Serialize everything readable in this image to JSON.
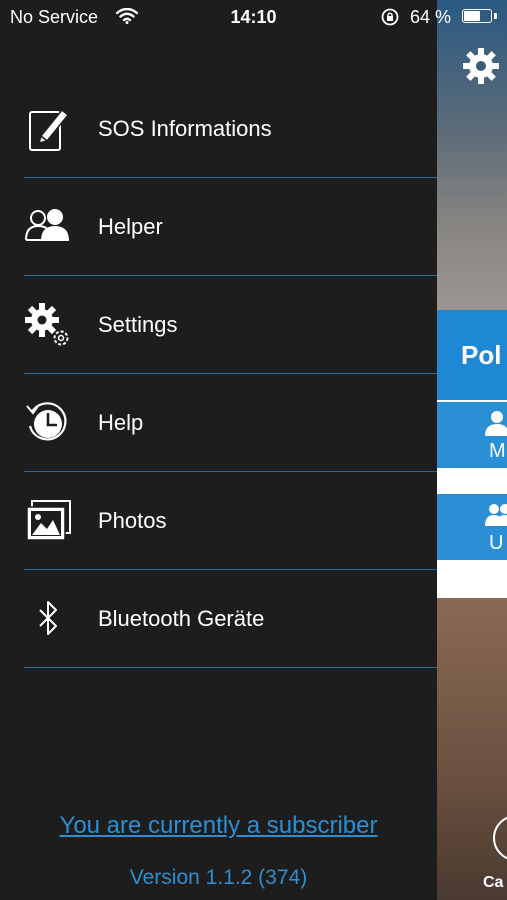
{
  "status_bar": {
    "carrier": "No Service",
    "time": "14:10",
    "battery_percent": "64 %",
    "battery_level": 0.64
  },
  "menu": {
    "items": [
      {
        "label": "SOS Informations",
        "icon": "edit-document-icon"
      },
      {
        "label": "Helper",
        "icon": "users-icon"
      },
      {
        "label": "Settings",
        "icon": "gears-icon"
      },
      {
        "label": "Help",
        "icon": "clock-history-icon"
      },
      {
        "label": "Photos",
        "icon": "photos-icon"
      },
      {
        "label": "Bluetooth Geräte",
        "icon": "bluetooth-icon"
      }
    ]
  },
  "footer": {
    "subscriber_link": "You are currently a subscriber",
    "version": "Version 1.1.2 (374)"
  },
  "background_app": {
    "panel_title": "Pol",
    "button1_label": "M",
    "button2_label": "U",
    "bottom_label": "Ca"
  },
  "colors": {
    "drawer_bg": "#1d1d1e",
    "divider": "#2c6b96",
    "link": "#2d8ed2",
    "panel_blue": "#1e88d4"
  }
}
